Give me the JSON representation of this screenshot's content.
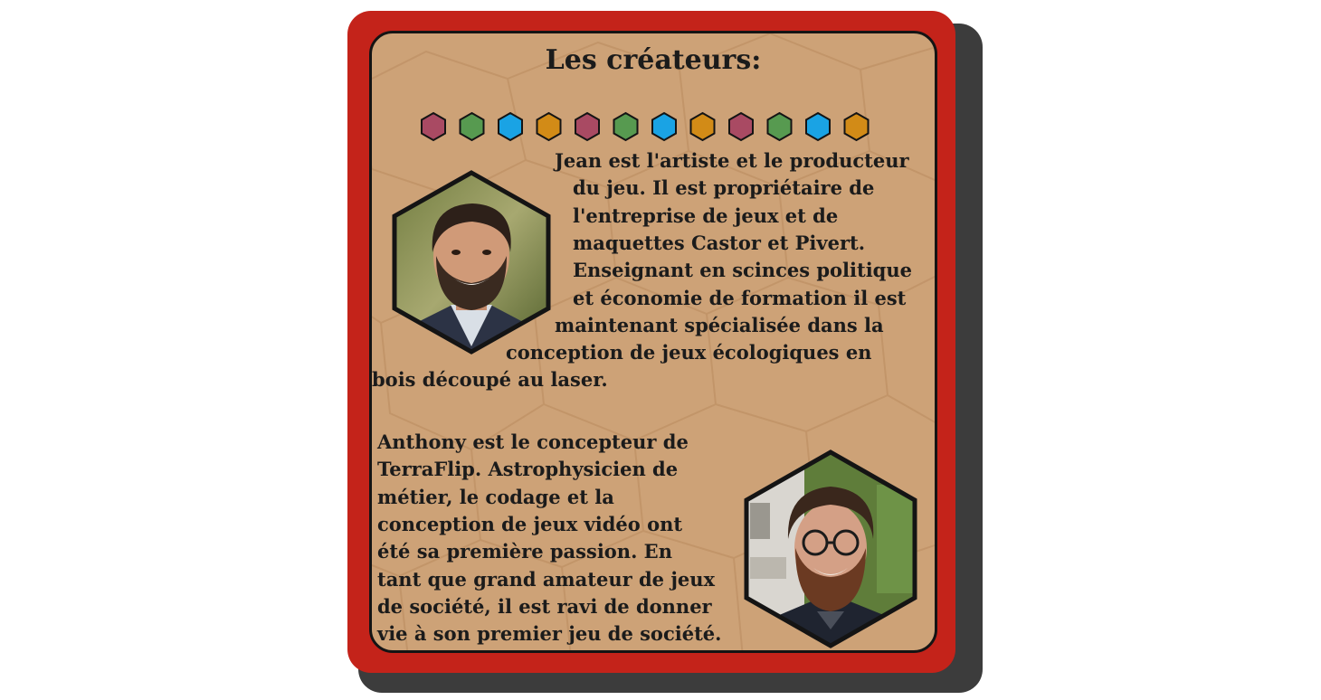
{
  "card": {
    "title": "Les créateurs:",
    "gem_colors": [
      "#a94a63",
      "#579a50",
      "#1aa3e4",
      "#d28b17",
      "#a94a63",
      "#579a50",
      "#1aa3e4",
      "#d28b17",
      "#a94a63",
      "#579a50",
      "#1aa3e4",
      "#d28b17"
    ],
    "colors": {
      "frame": "#c4231a",
      "parchment": "#cda277",
      "text": "#1b1b1b"
    },
    "creators": [
      {
        "portrait_icon": "bearded-man-portrait",
        "bio_lines": [
          "Jean est l'artiste et le producteur",
          "du jeu. Il est propriétaire de",
          "l'entreprise de jeux et de",
          "maquettes Castor et Pivert.",
          "Enseignant en scinces politique",
          "et économie de formation il est",
          "maintenant spécialisée dans la",
          "conception de jeux écologiques en",
          "bois découpé au laser."
        ]
      },
      {
        "portrait_icon": "bearded-man-with-glasses-portrait",
        "bio_lines": [
          "Anthony est le concepteur de",
          "TerraFlip. Astrophysicien de",
          "métier, le codage et la",
          "conception de jeux vidéo ont",
          "été sa première passion. En",
          "tant que grand amateur de jeux",
          "de société, il est ravi de donner",
          "vie à son premier jeu de société."
        ]
      }
    ]
  }
}
